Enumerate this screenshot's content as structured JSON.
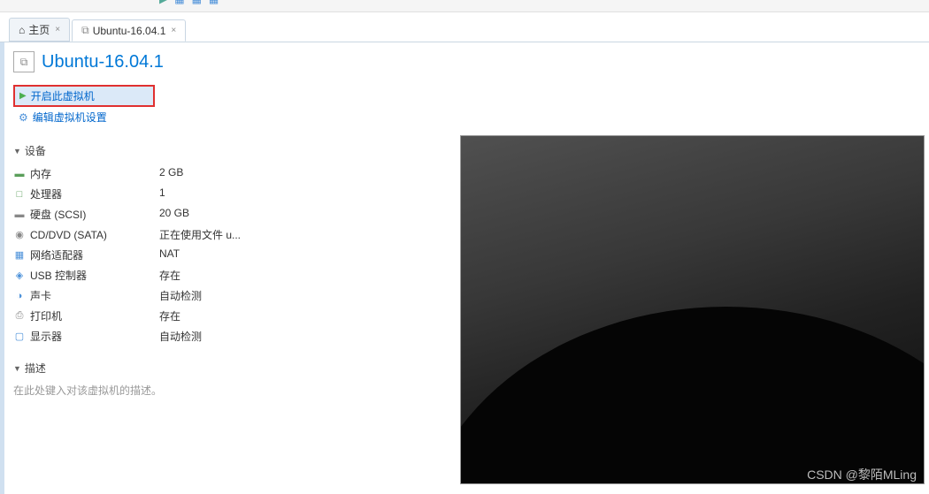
{
  "tabs": {
    "home": "主页",
    "vm": "Ubuntu-16.04.1"
  },
  "vm_title": "Ubuntu-16.04.1",
  "actions": {
    "power_on": "开启此虚拟机",
    "edit_settings": "编辑虚拟机设置"
  },
  "sections": {
    "devices": "设备",
    "description": "描述"
  },
  "devices": [
    {
      "icon": "▬",
      "cls": "icon-mem",
      "name": "内存",
      "value": "2 GB"
    },
    {
      "icon": "□",
      "cls": "icon-cpu",
      "name": "处理器",
      "value": "1"
    },
    {
      "icon": "▬",
      "cls": "icon-disk",
      "name": "硬盘 (SCSI)",
      "value": "20 GB"
    },
    {
      "icon": "◉",
      "cls": "icon-cd",
      "name": "CD/DVD (SATA)",
      "value": "正在使用文件 u..."
    },
    {
      "icon": "▦",
      "cls": "icon-net",
      "name": "网络适配器",
      "value": "NAT"
    },
    {
      "icon": "◈",
      "cls": "icon-usb",
      "name": "USB 控制器",
      "value": "存在"
    },
    {
      "icon": "◑",
      "cls": "icon-snd",
      "name": "声卡",
      "value": "自动检测"
    },
    {
      "icon": "⎙",
      "cls": "icon-prn",
      "name": "打印机",
      "value": "存在"
    },
    {
      "icon": "▢",
      "cls": "icon-disp",
      "name": "显示器",
      "value": "自动检测"
    }
  ],
  "description_placeholder": "在此处键入对该虚拟机的描述。",
  "watermark": "CSDN @黎陌MLing"
}
